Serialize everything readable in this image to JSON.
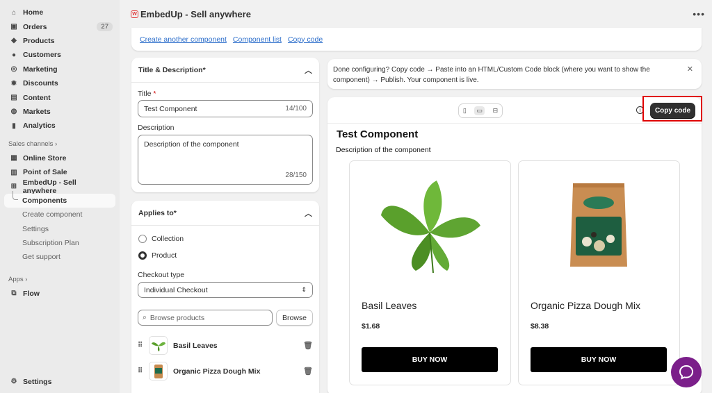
{
  "sidebar": {
    "items": [
      {
        "label": "Home",
        "icon": "home-icon"
      },
      {
        "label": "Orders",
        "icon": "orders-icon",
        "badge": "27"
      },
      {
        "label": "Products",
        "icon": "tag-icon"
      },
      {
        "label": "Customers",
        "icon": "person-icon"
      },
      {
        "label": "Marketing",
        "icon": "target-icon"
      },
      {
        "label": "Discounts",
        "icon": "discount-icon"
      },
      {
        "label": "Content",
        "icon": "content-icon"
      },
      {
        "label": "Markets",
        "icon": "globe-icon"
      },
      {
        "label": "Analytics",
        "icon": "bar-chart-icon"
      }
    ],
    "sales_channels_label": "Sales channels",
    "channels": [
      {
        "label": "Online Store",
        "icon": "store-icon"
      },
      {
        "label": "Point of Sale",
        "icon": "pos-icon"
      },
      {
        "label": "EmbedUp - Sell anywhere",
        "icon": "embedup-icon"
      }
    ],
    "sub_items": [
      "Components",
      "Create component",
      "Settings",
      "Subscription Plan",
      "Get support"
    ],
    "apps_label": "Apps",
    "apps": [
      {
        "label": "Flow",
        "icon": "flow-icon"
      }
    ],
    "settings_label": "Settings"
  },
  "header": {
    "title": "EmbedUp - Sell anywhere",
    "logo_letter": "W"
  },
  "links": [
    "Create another component",
    "Component list",
    "Copy code"
  ],
  "title_card": {
    "heading": "Title & Description*",
    "title_label": "Title",
    "title_value": "Test Component",
    "title_count": "14/100",
    "desc_label": "Description",
    "desc_value": "Description of the component",
    "desc_count": "28/150"
  },
  "applies_card": {
    "heading": "Applies to*",
    "options": [
      "Collection",
      "Product"
    ],
    "selected": "Product",
    "checkout_label": "Checkout type",
    "checkout_value": "Individual Checkout",
    "search_placeholder": "Browse products",
    "browse_label": "Browse",
    "products": [
      "Basil Leaves",
      "Organic Pizza Dough Mix"
    ]
  },
  "notice": {
    "text": "Done configuring? Copy code → Paste into an HTML/Custom Code block (where you want to show the component) → Publish. Your component is live."
  },
  "preview": {
    "copy_label": "Copy code",
    "title": "Test Component",
    "description": "Description of the component",
    "products": [
      {
        "name": "Basil Leaves",
        "price": "$1.68",
        "button": "BUY NOW"
      },
      {
        "name": "Organic Pizza Dough Mix",
        "price": "$8.38",
        "button": "BUY NOW"
      }
    ]
  },
  "colors": {
    "accent": "#2c6ecb",
    "highlight": "#e00000",
    "chat": "#7b1f8a"
  }
}
